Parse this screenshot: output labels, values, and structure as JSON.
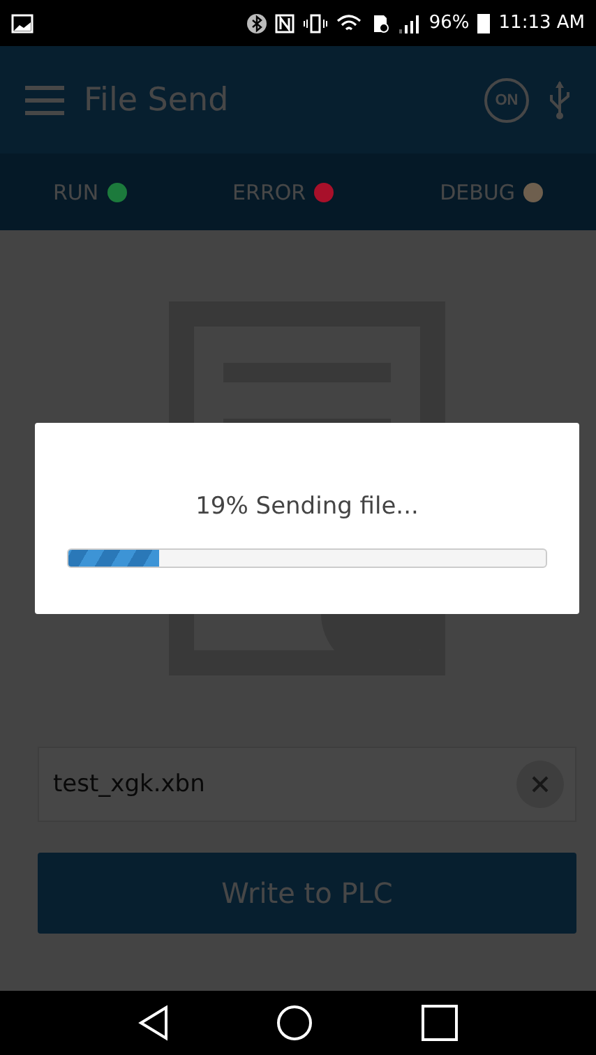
{
  "status_bar": {
    "battery": "96%",
    "time": "11:13 AM"
  },
  "app_bar": {
    "title": "File Send",
    "toggle": "ON"
  },
  "indicators": [
    {
      "label": "RUN",
      "color": "#1c7a3c"
    },
    {
      "label": "ERROR",
      "color": "#a8102a"
    },
    {
      "label": "DEBUG",
      "color": "#6e5f4e"
    }
  ],
  "file_field": {
    "value": "test_xgk.xbn"
  },
  "write_button": "Write to PLC",
  "dialog": {
    "message": "19% Sending file...",
    "level": 0.19
  }
}
